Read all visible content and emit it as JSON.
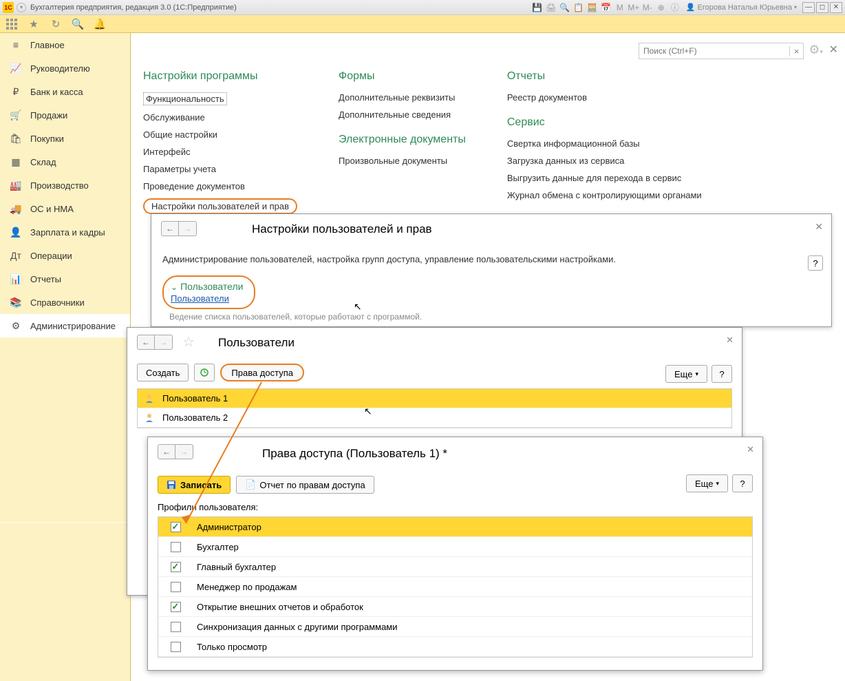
{
  "titlebar": {
    "logo": "1C",
    "title": "Бухгалтерия предприятия, редакция 3.0  (1С:Предприятие)",
    "m_buttons": [
      "M",
      "M+",
      "M-"
    ],
    "user": "Егорова Наталья Юрьевна"
  },
  "search": {
    "placeholder": "Поиск (Ctrl+F)"
  },
  "nav": [
    {
      "icon": "≡",
      "label": "Главное"
    },
    {
      "icon": "📈",
      "label": "Руководителю"
    },
    {
      "icon": "₽",
      "label": "Банк и касса"
    },
    {
      "icon": "🛒",
      "label": "Продажи"
    },
    {
      "icon": "🛍",
      "label": "Покупки"
    },
    {
      "icon": "▦",
      "label": "Склад"
    },
    {
      "icon": "🏭",
      "label": "Производство"
    },
    {
      "icon": "🚚",
      "label": "ОС и НМА"
    },
    {
      "icon": "👤",
      "label": "Зарплата и кадры"
    },
    {
      "icon": "Дт",
      "label": "Операции"
    },
    {
      "icon": "📊",
      "label": "Отчеты"
    },
    {
      "icon": "📚",
      "label": "Справочники"
    },
    {
      "icon": "⚙",
      "label": "Администрирование"
    }
  ],
  "sections": {
    "col1": {
      "title": "Настройки программы",
      "links": [
        "Функциональность",
        "Обслуживание",
        "Общие настройки",
        "Интерфейс",
        "Параметры учета",
        "Проведение документов",
        "Настройки пользователей и прав"
      ]
    },
    "col2a": {
      "title": "Формы",
      "links": [
        "Дополнительные реквизиты",
        "Дополнительные сведения"
      ]
    },
    "col2b": {
      "title": "Электронные документы",
      "links": [
        "Произвольные документы"
      ]
    },
    "col3a": {
      "title": "Отчеты",
      "links": [
        "Реестр документов"
      ]
    },
    "col3b": {
      "title": "Сервис",
      "links": [
        "Свертка информационной базы",
        "Загрузка данных из сервиса",
        "Выгрузить данные для перехода в сервис",
        "Журнал обмена с контролирующими органами"
      ]
    }
  },
  "panel1": {
    "title": "Настройки пользователей и прав",
    "desc": "Администрирование пользователей, настройка групп доступа, управление пользовательскими настройками.",
    "users_header": "Пользователи",
    "users_link": "Пользователи",
    "hint": "Ведение списка пользователей, которые работают с программой.",
    "help": "?"
  },
  "panel2": {
    "title": "Пользователи",
    "create": "Создать",
    "rights": "Права доступа",
    "more": "Еще",
    "help": "?",
    "users": [
      "Пользователь 1",
      "Пользователь 2"
    ]
  },
  "panel3": {
    "title": "Права доступа (Пользователь 1) *",
    "save": "Записать",
    "report": "Отчет по правам доступа",
    "more": "Еще",
    "help": "?",
    "profiles_label": "Профили пользователя:",
    "profiles": [
      {
        "name": "Администратор",
        "checked": true,
        "sel": true
      },
      {
        "name": "Бухгалтер",
        "checked": false
      },
      {
        "name": "Главный бухгалтер",
        "checked": true
      },
      {
        "name": "Менеджер по продажам",
        "checked": false
      },
      {
        "name": "Открытие внешних отчетов и обработок",
        "checked": true
      },
      {
        "name": "Синхронизация данных с другими программами",
        "checked": false
      },
      {
        "name": "Только просмотр",
        "checked": false
      }
    ]
  }
}
